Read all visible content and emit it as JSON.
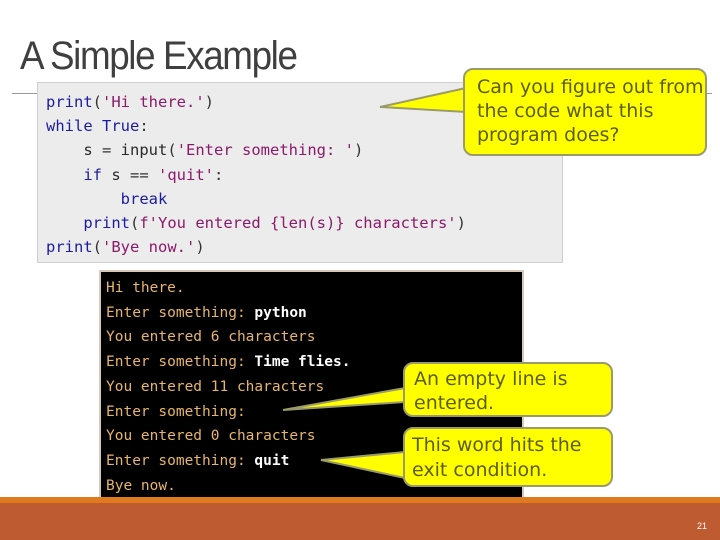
{
  "slide": {
    "title": "A Simple Example",
    "page_number": "21"
  },
  "code": {
    "lines": [
      [
        {
          "t": "print",
          "c": "kw"
        },
        {
          "t": "(",
          "c": "pl"
        },
        {
          "t": "'Hi there.'",
          "c": "str"
        },
        {
          "t": ")",
          "c": "pl"
        }
      ],
      [
        {
          "t": "while",
          "c": "kw"
        },
        {
          "t": " ",
          "c": "pl"
        },
        {
          "t": "True",
          "c": "kw"
        },
        {
          "t": ":",
          "c": "pl"
        }
      ],
      [
        {
          "t": "    s ",
          "c": "ident"
        },
        {
          "t": "=",
          "c": "pl"
        },
        {
          "t": " input",
          "c": "ident"
        },
        {
          "t": "(",
          "c": "pl"
        },
        {
          "t": "'Enter something: '",
          "c": "str"
        },
        {
          "t": ")",
          "c": "pl"
        }
      ],
      [
        {
          "t": "    if",
          "c": "kw"
        },
        {
          "t": " s ",
          "c": "ident"
        },
        {
          "t": "==",
          "c": "pl"
        },
        {
          "t": " ",
          "c": "pl"
        },
        {
          "t": "'quit'",
          "c": "str"
        },
        {
          "t": ":",
          "c": "pl"
        }
      ],
      [
        {
          "t": "        break",
          "c": "kw"
        }
      ],
      [
        {
          "t": "    print",
          "c": "kw"
        },
        {
          "t": "(",
          "c": "pl"
        },
        {
          "t": "f'You entered {len(s)} characters'",
          "c": "str"
        },
        {
          "t": ")",
          "c": "pl"
        }
      ],
      [
        {
          "t": "print",
          "c": "kw"
        },
        {
          "t": "(",
          "c": "pl"
        },
        {
          "t": "'Bye now.'",
          "c": "str"
        },
        {
          "t": ")",
          "c": "pl"
        }
      ]
    ]
  },
  "console": {
    "lines": [
      {
        "out": "Hi there.",
        "inp": ""
      },
      {
        "out": "Enter something: ",
        "inp": "python"
      },
      {
        "out": "You entered 6 characters",
        "inp": ""
      },
      {
        "out": "Enter something: ",
        "inp": "Time flies."
      },
      {
        "out": "You entered 11 characters",
        "inp": ""
      },
      {
        "out": "Enter something:",
        "inp": ""
      },
      {
        "out": "You entered 0 characters",
        "inp": ""
      },
      {
        "out": "Enter something: ",
        "inp": "quit"
      },
      {
        "out": "Bye now.",
        "inp": ""
      }
    ],
    "prompt": ">>>"
  },
  "callouts": {
    "question": "Can you figure out from the code what this program does?",
    "empty_line": "An empty line is entered.",
    "exit_word": "This word hits the exit condition."
  },
  "colors": {
    "callout_fill": "#ffff00",
    "footer": "#bf5b30",
    "footer_accent": "#e07a1e",
    "console_text": "#e8b56a",
    "keyword": "#1c1ca0",
    "string": "#8c1a6b"
  }
}
